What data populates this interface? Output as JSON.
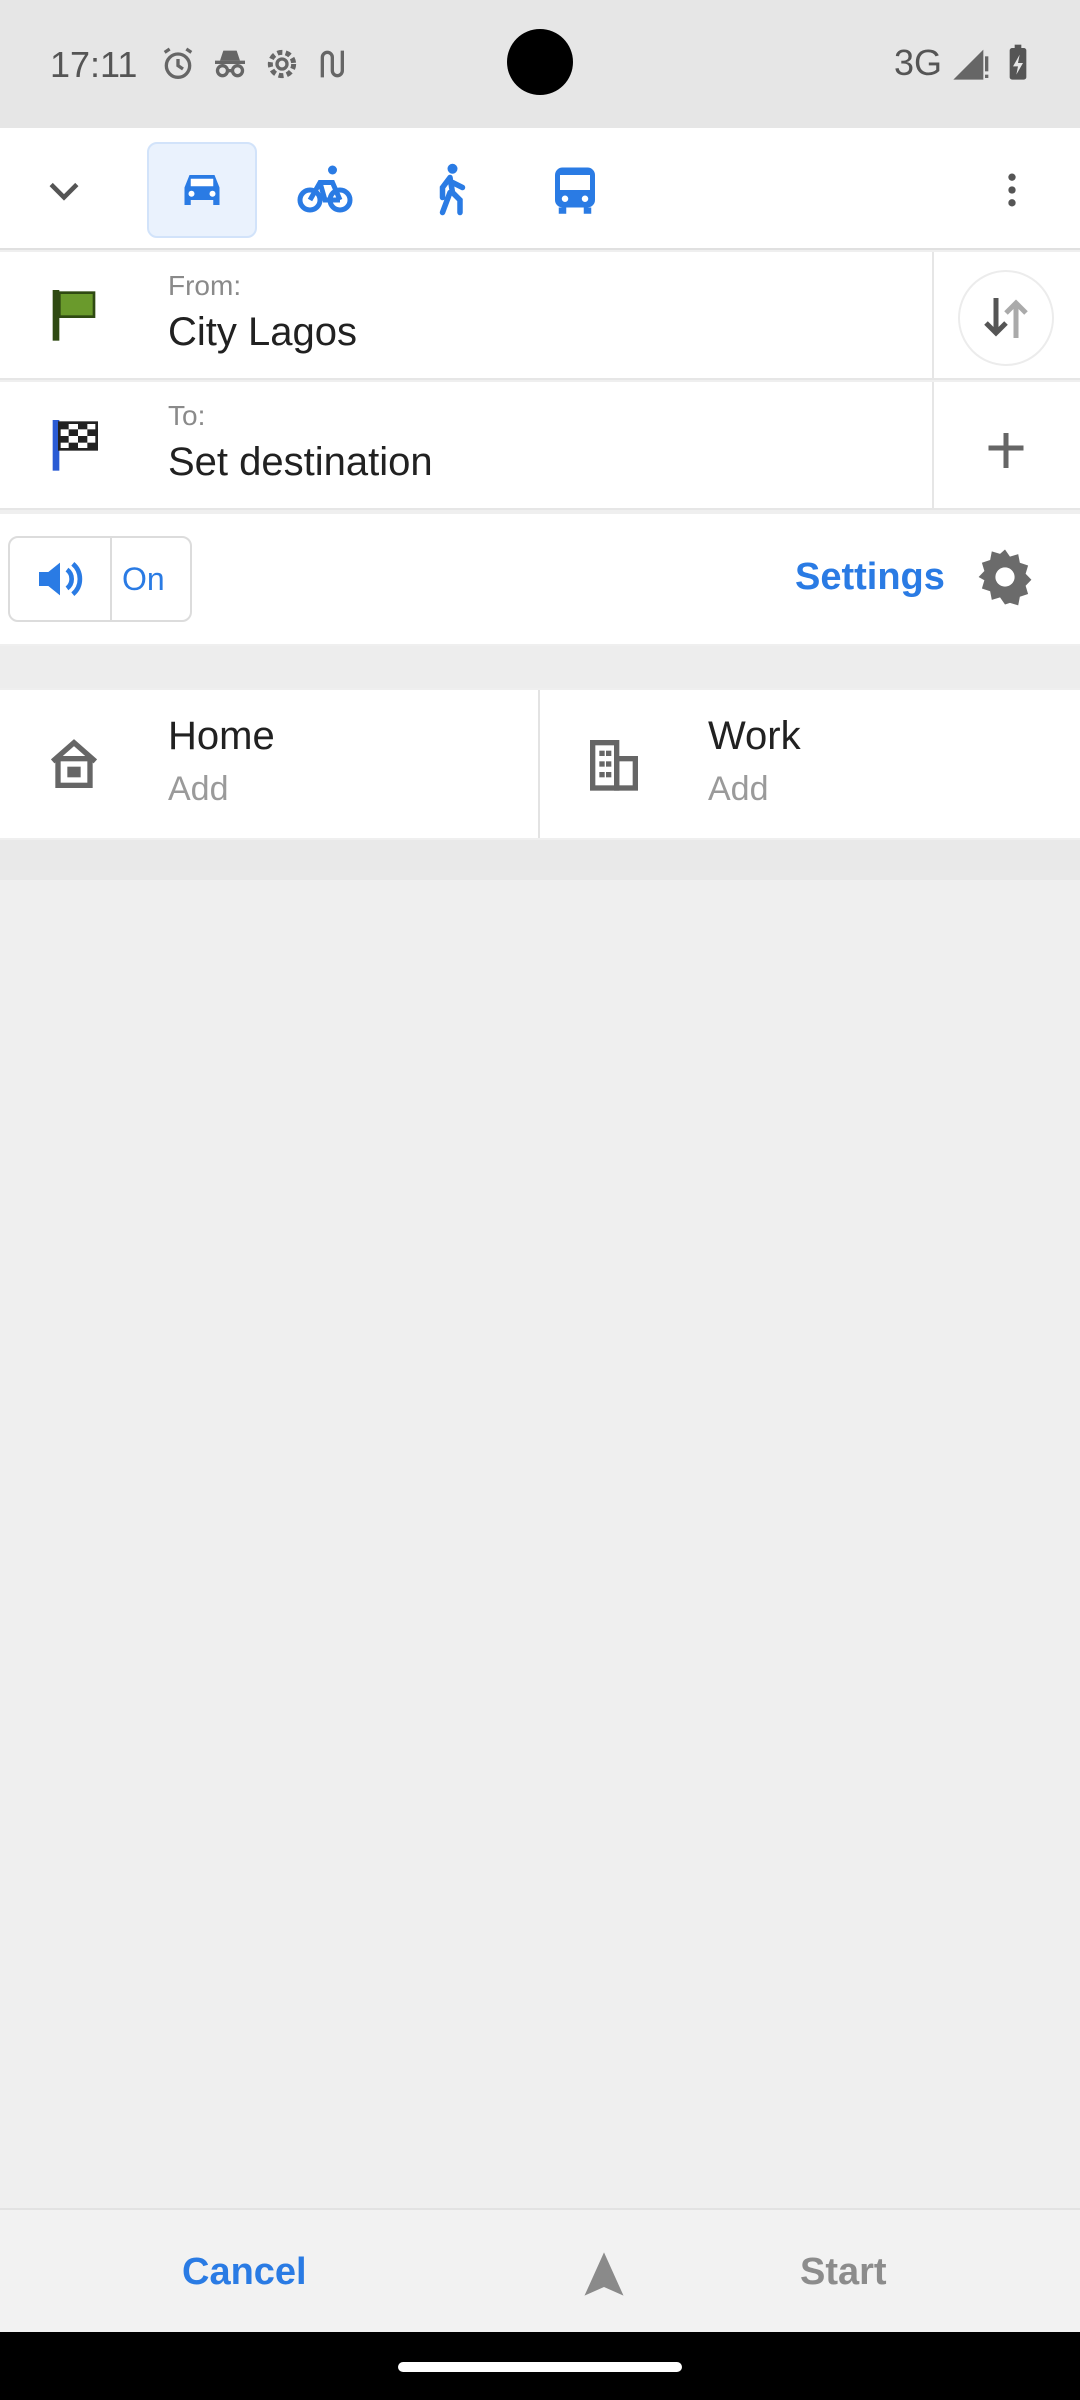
{
  "status_bar": {
    "time": "17:11",
    "left_icons": [
      "alarm-icon",
      "incognito-icon",
      "settings-cog-icon",
      "route-icon"
    ],
    "network": "3G",
    "right_icons": [
      "signal-icon",
      "battery-charging-icon"
    ]
  },
  "mode_bar": {
    "modes": [
      {
        "id": "car",
        "icon": "car-icon",
        "selected": true
      },
      {
        "id": "bike",
        "icon": "bicycle-icon",
        "selected": false
      },
      {
        "id": "walk",
        "icon": "pedestrian-icon",
        "selected": false
      },
      {
        "id": "transit",
        "icon": "bus-icon",
        "selected": false
      }
    ]
  },
  "route": {
    "from_caption": "From:",
    "from_value": "City Lagos",
    "to_caption": "To:",
    "to_value": "Set destination"
  },
  "voice": {
    "state": "On",
    "settings_label": "Settings"
  },
  "favorites": [
    {
      "title": "Home",
      "subtitle": "Add",
      "icon": "home-icon"
    },
    {
      "title": "Work",
      "subtitle": "Add",
      "icon": "office-icon"
    }
  ],
  "bottom_bar": {
    "cancel_label": "Cancel",
    "start_label": "Start"
  },
  "colors": {
    "accent": "#2a7be4",
    "flag_green": "#6a9a2c"
  }
}
